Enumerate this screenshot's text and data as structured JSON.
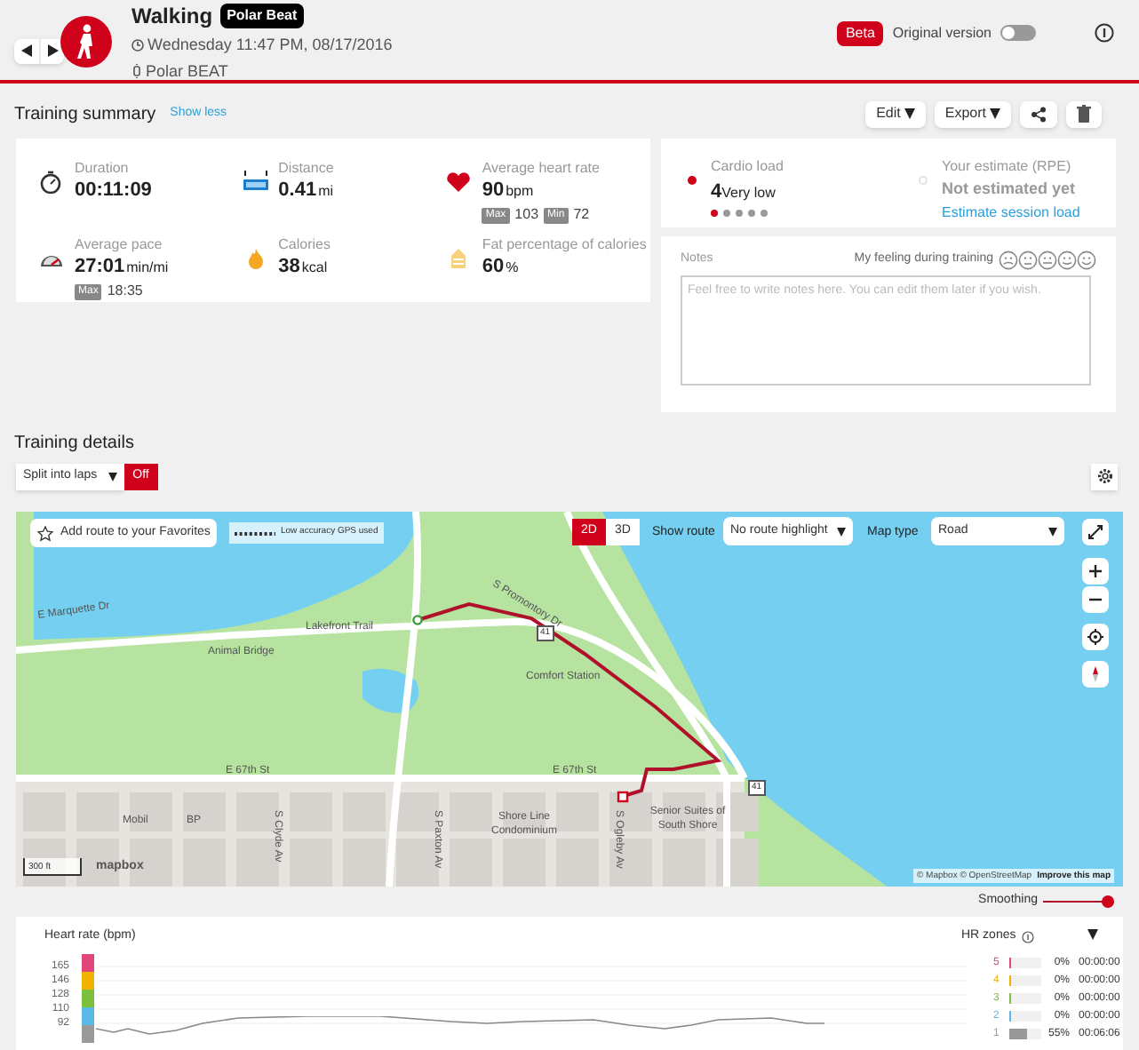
{
  "header": {
    "title": "Walking",
    "badge": "Polar Beat",
    "datetime": "Wednesday 11:47 PM, 08/17/2016",
    "device": "Polar BEAT",
    "beta": "Beta",
    "original_version": {
      "label": "Original version",
      "on": false
    }
  },
  "summary": {
    "title": "Training summary",
    "toggle_link": "Show less",
    "metrics": [
      {
        "kind": "duration",
        "label": "Duration",
        "value": "00:11:09"
      },
      {
        "kind": "distance",
        "label": "Distance",
        "value": "0.41",
        "unit": "mi"
      },
      {
        "kind": "heart",
        "label": "Average heart rate",
        "value": "90",
        "unit": "bpm",
        "extras": [
          {
            "tag": "Max",
            "value": "103"
          },
          {
            "tag": "Min",
            "value": "72"
          }
        ]
      },
      {
        "kind": "pace",
        "label": "Average pace",
        "value": "27:01",
        "unit": "min/mi",
        "extras": [
          {
            "tag": "Max",
            "value": "18:35"
          }
        ]
      },
      {
        "kind": "calories",
        "label": "Calories",
        "value": "38",
        "unit": "kcal"
      },
      {
        "kind": "fat",
        "label": "Fat percentage of calories",
        "value": "60",
        "unit": "%"
      }
    ]
  },
  "actions": [
    {
      "kind": "dropdown",
      "label": "Edit"
    },
    {
      "kind": "dropdown",
      "label": "Export"
    },
    {
      "kind": "share"
    },
    {
      "kind": "delete"
    }
  ],
  "cardio_load": {
    "label": "Cardio load",
    "value": "4",
    "text": "Very low",
    "stars": 1
  },
  "rpe": {
    "label": "Your estimate (RPE)",
    "value": "Not estimated yet",
    "link": "Estimate session load"
  },
  "notes": {
    "label": "Notes",
    "feeling_label": "My feeling during training",
    "feelings": [
      {
        "selected": false
      },
      {
        "selected": false
      },
      {
        "selected": false
      },
      {
        "selected": false
      },
      {
        "selected": false
      }
    ],
    "placeholder": "Feel free to write notes here. You can edit them later if you wish."
  },
  "details": {
    "title": "Training details",
    "split": {
      "label": "Split into laps",
      "toggle": "Off"
    }
  },
  "map": {
    "favorite": "Add route to your Favorites",
    "gps_legend": "Low accuracy GPS used",
    "views": [
      {
        "label": "2D",
        "selected": true
      },
      {
        "label": "3D",
        "selected": false
      }
    ],
    "show_route_label": "Show route",
    "show_route": "No route highlight",
    "map_type_label": "Map type",
    "map_type": "Road",
    "labels": [
      "E Marquette Dr",
      "Animal Bridge",
      "Lakefront Trail",
      "S Promontory Dr",
      "Comfort Station",
      "E 67th St",
      "E 67th St",
      "Mobil",
      "BP",
      "Shore Line Condominium",
      "Senior Suites of South Shore",
      "S Clyde Av",
      "S Paxton Av",
      "S Ogleby Av"
    ],
    "shields": [
      "41",
      "41"
    ],
    "scale": "300 ft",
    "logo": "mapbox",
    "attribution": "© Mapbox © OpenStreetMap",
    "improve": "Improve this map"
  },
  "smoothing": {
    "label": "Smoothing",
    "on": true
  },
  "hr": {
    "title": "Heart rate (bpm)",
    "ticks": [
      "165",
      "146",
      "128",
      "110",
      "92"
    ],
    "zones_title": "HR zones",
    "zones": [
      {
        "number": "5",
        "color": "#e0457b",
        "percent": "0%",
        "time": "00:00:00"
      },
      {
        "number": "4",
        "color": "#f0b400",
        "percent": "0%",
        "time": "00:00:00"
      },
      {
        "number": "3",
        "color": "#7cbf3c",
        "percent": "0%",
        "time": "00:00:00"
      },
      {
        "number": "2",
        "color": "#5ab8e6",
        "percent": "0%",
        "time": "00:00:00"
      },
      {
        "number": "1",
        "color": "#9a9a9a",
        "percent": "55%",
        "time": "00:06:06",
        "level": 0.55
      }
    ]
  }
}
